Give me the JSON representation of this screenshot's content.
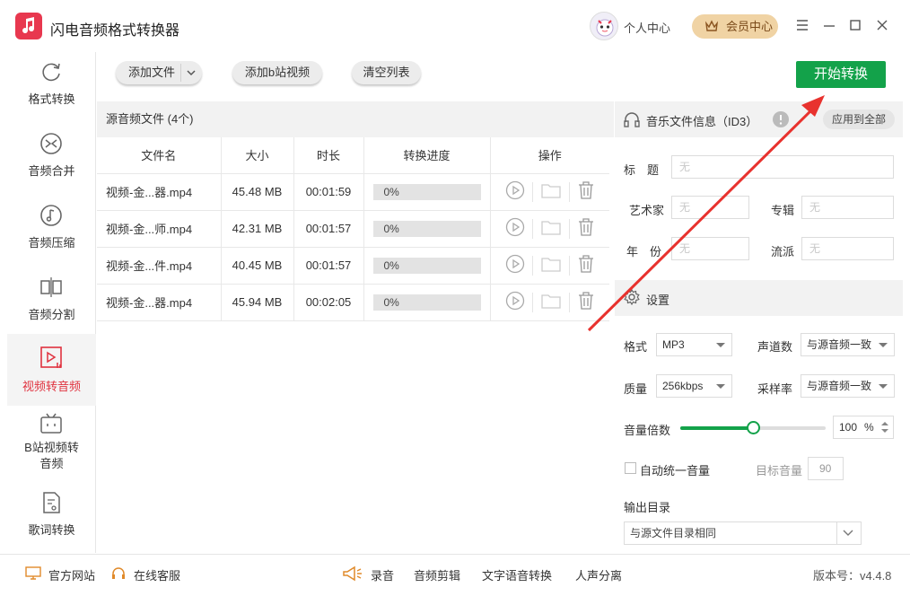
{
  "app": {
    "title": "闪电音频格式转换器"
  },
  "header": {
    "user_center": "个人中心",
    "vip_label": "会员中心"
  },
  "sidebar": {
    "items": [
      {
        "label": "格式转换",
        "icon": "refresh-icon"
      },
      {
        "label": "音频合并",
        "icon": "merge-icon"
      },
      {
        "label": "音频压缩",
        "icon": "music-note-icon"
      },
      {
        "label": "音频分割",
        "icon": "split-icon"
      },
      {
        "label": "视频转音频",
        "icon": "video-audio-icon",
        "active": true
      },
      {
        "label": "B站视频转\n音频",
        "icon": "bilibili-icon"
      },
      {
        "label": "歌词转换",
        "icon": "lyrics-icon"
      }
    ]
  },
  "toolbar": {
    "add_file": "添加文件",
    "add_bilibili": "添加b站视频",
    "clear_list": "清空列表",
    "start": "开始转换"
  },
  "files": {
    "header": "源音频文件 (4个)",
    "columns": [
      "文件名",
      "大小",
      "时长",
      "转换进度",
      "操作"
    ],
    "rows": [
      {
        "name": "视频-金...器.mp4",
        "size": "45.48 MB",
        "duration": "00:01:59",
        "progress": "0%"
      },
      {
        "name": "视频-金...师.mp4",
        "size": "42.31 MB",
        "duration": "00:01:57",
        "progress": "0%"
      },
      {
        "name": "视频-金...件.mp4",
        "size": "40.45 MB",
        "duration": "00:01:57",
        "progress": "0%"
      },
      {
        "name": "视频-金...器.mp4",
        "size": "45.94 MB",
        "duration": "00:02:05",
        "progress": "0%"
      }
    ]
  },
  "id3": {
    "header": "音乐文件信息（ID3）",
    "apply_all": "应用到全部",
    "title_label": "标　题",
    "artist_label": "艺术家",
    "album_label": "专辑",
    "year_label": "年　份",
    "genre_label": "流派",
    "placeholder": "无"
  },
  "settings": {
    "header": "设置",
    "format_label": "格式",
    "format_value": "MP3",
    "channel_label": "声道数",
    "channel_value": "与源音频一致",
    "quality_label": "质量",
    "quality_value": "256kbps",
    "samplerate_label": "采样率",
    "samplerate_value": "与源音频一致",
    "volume_label": "音量倍数",
    "volume_value": "100",
    "volume_unit": "%",
    "volume_fraction": 0.5,
    "auto_volume_label": "自动统一音量",
    "target_volume_label": "目标音量",
    "target_volume_value": "90",
    "output_dir_label": "输出目录",
    "output_dir_value": "与源文件目录相同"
  },
  "bottom": {
    "website": "官方网站",
    "support": "在线客服",
    "record": "录音",
    "audio_edit": "音频剪辑",
    "tts": "文字语音转换",
    "vocal_sep": "人声分离",
    "version": "版本号：v4.4.8"
  },
  "colors": {
    "accent_green": "#13a24a",
    "active_red": "#e0323f",
    "arrow_red": "#e8322e",
    "logo_red": "#e8384f"
  }
}
